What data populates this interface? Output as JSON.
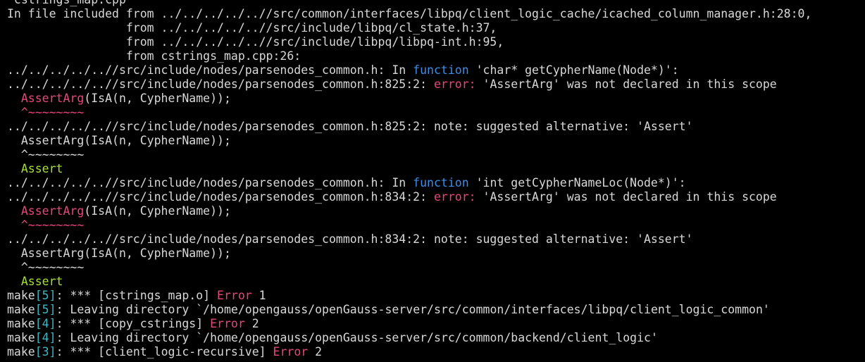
{
  "terminal": {
    "lines": [
      [
        {
          "t": " cstrings_map.cpp",
          "c": "white"
        }
      ],
      [
        {
          "t": "In file included from ../../../../..//src/common/interfaces/libpq/client_logic_cache/icached_column_manager.h:28:0,",
          "c": "white"
        }
      ],
      [
        {
          "t": "                 from ../../../../..//src/include/libpq/cl_state.h:37,",
          "c": "white"
        }
      ],
      [
        {
          "t": "                 from ../../../../..//src/include/libpq/libpq-int.h:95,",
          "c": "white"
        }
      ],
      [
        {
          "t": "                 from cstrings_map.cpp:26:",
          "c": "white"
        }
      ],
      [
        {
          "t": "../../../../..//src/include/nodes/parsenodes_common.h: In ",
          "c": "white"
        },
        {
          "t": "function",
          "c": "blue"
        },
        {
          "t": " 'char* getCypherName(Node*)':",
          "c": "white"
        }
      ],
      [
        {
          "t": "../../../../..//src/include/nodes/parsenodes_common.h:825:2: ",
          "c": "white"
        },
        {
          "t": "error:",
          "c": "magenta"
        },
        {
          "t": " 'AssertArg' was not declared in this scope",
          "c": "white"
        }
      ],
      [
        {
          "t": "  ",
          "c": "white"
        },
        {
          "t": "AssertArg",
          "c": "magenta"
        },
        {
          "t": "(IsA(n, CypherName));",
          "c": "white"
        }
      ],
      [
        {
          "t": "  ",
          "c": "white"
        },
        {
          "t": "^~~~~~~~~",
          "c": "magenta"
        }
      ],
      [
        {
          "t": "../../../../..//src/include/nodes/parsenodes_common.h:825:2: note: suggested alternative: 'Assert'",
          "c": "white"
        }
      ],
      [
        {
          "t": "  AssertArg(IsA(n, CypherName));",
          "c": "white"
        }
      ],
      [
        {
          "t": "  ^~~~~~~~~",
          "c": "white"
        }
      ],
      [
        {
          "t": "  ",
          "c": "white"
        },
        {
          "t": "Assert",
          "c": "green"
        }
      ],
      [
        {
          "t": "../../../../..//src/include/nodes/parsenodes_common.h: In ",
          "c": "white"
        },
        {
          "t": "function",
          "c": "blue"
        },
        {
          "t": " 'int getCypherNameLoc(Node*)':",
          "c": "white"
        }
      ],
      [
        {
          "t": "../../../../..//src/include/nodes/parsenodes_common.h:834:2: ",
          "c": "white"
        },
        {
          "t": "error:",
          "c": "magenta"
        },
        {
          "t": " 'AssertArg' was not declared in this scope",
          "c": "white"
        }
      ],
      [
        {
          "t": "  ",
          "c": "white"
        },
        {
          "t": "AssertArg",
          "c": "magenta"
        },
        {
          "t": "(IsA(n, CypherName));",
          "c": "white"
        }
      ],
      [
        {
          "t": "  ",
          "c": "white"
        },
        {
          "t": "^~~~~~~~~",
          "c": "magenta"
        }
      ],
      [
        {
          "t": "../../../../..//src/include/nodes/parsenodes_common.h:834:2: note: suggested alternative: 'Assert'",
          "c": "white"
        }
      ],
      [
        {
          "t": "  AssertArg(IsA(n, CypherName));",
          "c": "white"
        }
      ],
      [
        {
          "t": "  ^~~~~~~~~",
          "c": "white"
        }
      ],
      [
        {
          "t": "  ",
          "c": "white"
        },
        {
          "t": "Assert",
          "c": "green"
        }
      ],
      [
        {
          "t": "make",
          "c": "white"
        },
        {
          "t": "[5]",
          "c": "cyan"
        },
        {
          "t": ": *** [cstrings_map.o] ",
          "c": "white"
        },
        {
          "t": "Error",
          "c": "magenta"
        },
        {
          "t": " 1",
          "c": "white"
        }
      ],
      [
        {
          "t": "make",
          "c": "white"
        },
        {
          "t": "[5]",
          "c": "cyan"
        },
        {
          "t": ": Leaving directory `/home/opengauss/openGauss-server/src/common/interfaces/libpq/client_logic_common'",
          "c": "white"
        }
      ],
      [
        {
          "t": "make",
          "c": "white"
        },
        {
          "t": "[4]",
          "c": "cyan"
        },
        {
          "t": ": *** [copy_cstrings] ",
          "c": "white"
        },
        {
          "t": "Error",
          "c": "magenta"
        },
        {
          "t": " 2",
          "c": "white"
        }
      ],
      [
        {
          "t": "make",
          "c": "white"
        },
        {
          "t": "[4]",
          "c": "cyan"
        },
        {
          "t": ": Leaving directory `/home/opengauss/openGauss-server/src/common/backend/client_logic'",
          "c": "white"
        }
      ],
      [
        {
          "t": "make",
          "c": "white"
        },
        {
          "t": "[3]",
          "c": "cyan"
        },
        {
          "t": ": *** [client_logic-recursive] ",
          "c": "white"
        },
        {
          "t": "Error",
          "c": "magenta"
        },
        {
          "t": " 2",
          "c": "white"
        }
      ]
    ],
    "colors": {
      "background": "#000000",
      "text": "#d8d8d8",
      "error": "#e8467c",
      "keyword": "#3b8eea",
      "suggestion": "#a6e22e",
      "make_level": "#3bb7c4"
    }
  }
}
